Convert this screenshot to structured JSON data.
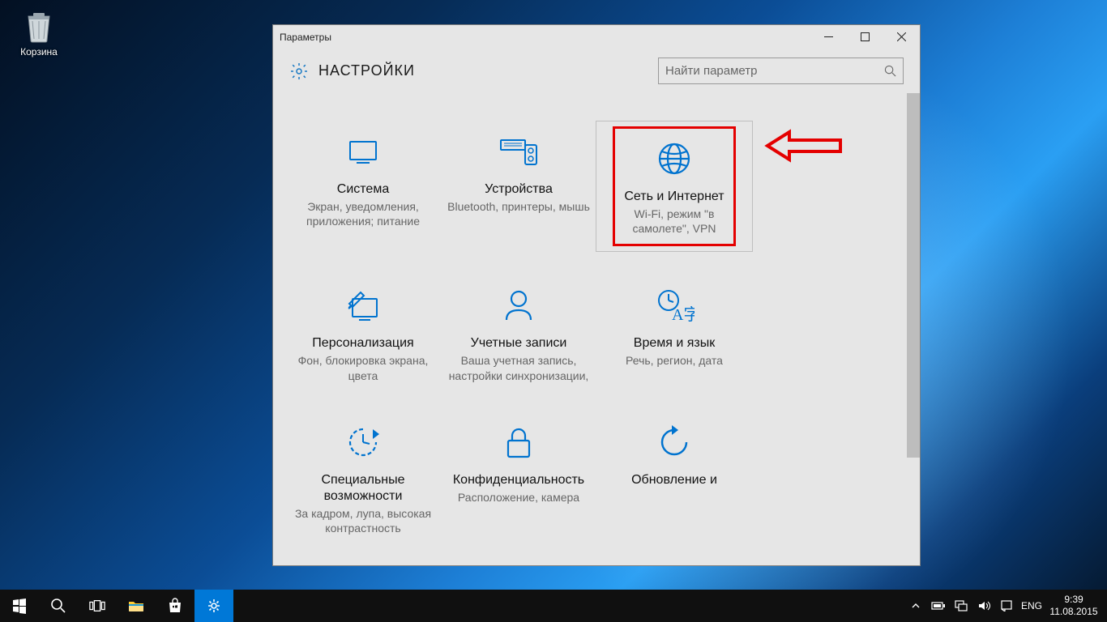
{
  "desktop": {
    "recycle_label": "Корзина"
  },
  "window": {
    "caption": "Параметры",
    "title": "НАСТРОЙКИ",
    "search_placeholder": "Найти параметр"
  },
  "tiles": [
    {
      "name": "Система",
      "desc": "Экран, уведомления, приложения; питание"
    },
    {
      "name": "Устройства",
      "desc": "Bluetooth, принтеры, мышь"
    },
    {
      "name": "Сеть и Интернет",
      "desc": "Wi-Fi, режим \"в самолете\", VPN"
    },
    {
      "name": "Персонализация",
      "desc": "Фон, блокировка экрана, цвета"
    },
    {
      "name": "Учетные записи",
      "desc": "Ваша учетная запись, настройки синхронизации,"
    },
    {
      "name": "Время и язык",
      "desc": "Речь, регион, дата"
    },
    {
      "name": "Специальные возможности",
      "desc": "За кадром, лупа, высокая контрастность"
    },
    {
      "name": "Конфиденциальность",
      "desc": "Расположение, камера"
    },
    {
      "name": "Обновление и",
      "desc": ""
    }
  ],
  "taskbar": {
    "lang": "ENG",
    "time": "9:39",
    "date": "11.08.2015"
  }
}
